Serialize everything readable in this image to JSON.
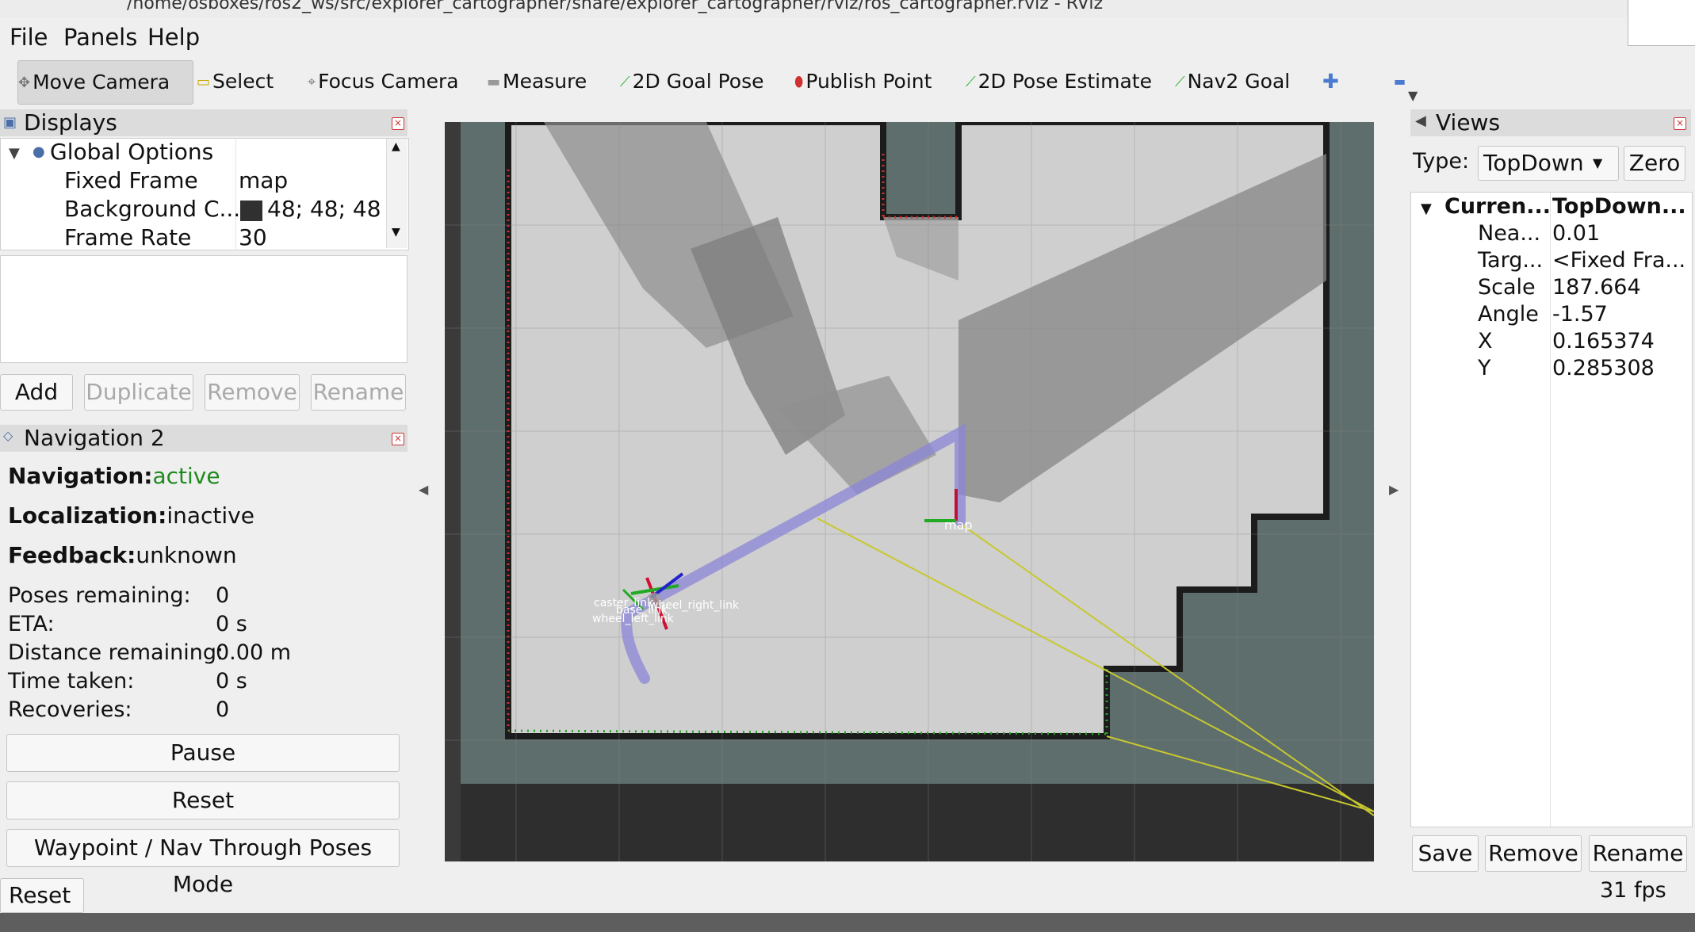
{
  "window": {
    "title_path": "/home/osboxes/ros2_ws/src/explorer_cartographer/share/explorer_cartographer/rviz/ros_cartographer.rviz - RViz"
  },
  "menu": [
    "File",
    "Panels",
    "Help"
  ],
  "toolbar": {
    "move_camera": "Move Camera",
    "select": "Select",
    "focus_camera": "Focus Camera",
    "measure": "Measure",
    "goal_pose": "2D Goal Pose",
    "publish_point": "Publish Point",
    "pose_estimate": "2D Pose Estimate",
    "nav2_goal": "Nav2 Goal"
  },
  "displays": {
    "title": "Displays",
    "global_options": "Global Options",
    "rows": [
      {
        "label": "Fixed Frame",
        "value": "map"
      },
      {
        "label": "Background C...",
        "value": "48; 48; 48"
      },
      {
        "label": "Frame Rate",
        "value": "30"
      }
    ],
    "background_color": "#303030",
    "buttons": {
      "add": "Add",
      "duplicate": "Duplicate",
      "remove": "Remove",
      "rename": "Rename"
    }
  },
  "navigation": {
    "title": "Navigation 2",
    "nav_label": "Navigation:",
    "nav_value": "active",
    "loc_label": "Localization:",
    "loc_value": "inactive",
    "feedback_label": "Feedback:",
    "feedback_value": "unknown",
    "stats": [
      {
        "label": "Poses remaining:",
        "value": "0"
      },
      {
        "label": "ETA:",
        "value": "0 s"
      },
      {
        "label": "Distance remaining:",
        "value": "0.00 m"
      },
      {
        "label": "Time taken:",
        "value": "0 s"
      },
      {
        "label": "Recoveries:",
        "value": "0"
      }
    ],
    "pause": "Pause",
    "reset": "Reset",
    "mode": "Waypoint / Nav Through Poses Mode"
  },
  "bottom": {
    "reset": "Reset",
    "fps": "31 fps"
  },
  "views": {
    "title": "Views",
    "type_label": "Type:",
    "type_value": "TopDown",
    "zero": "Zero",
    "current_label": "Curren...",
    "current_value": "TopDown...",
    "rows": [
      {
        "label": "Nea...",
        "value": "0.01"
      },
      {
        "label": "Targ...",
        "value": "<Fixed Fra..."
      },
      {
        "label": "Scale",
        "value": "187.664"
      },
      {
        "label": "Angle",
        "value": "-1.57"
      },
      {
        "label": "X",
        "value": "0.165374"
      },
      {
        "label": "Y",
        "value": "0.285308"
      }
    ],
    "save": "Save",
    "remove": "Remove",
    "rename": "Rename"
  },
  "scene": {
    "map_frame_label": "map",
    "robot_frame_labels": [
      "caster_link",
      "base_link",
      "wheel_right_link",
      "wheel_left_link"
    ]
  }
}
